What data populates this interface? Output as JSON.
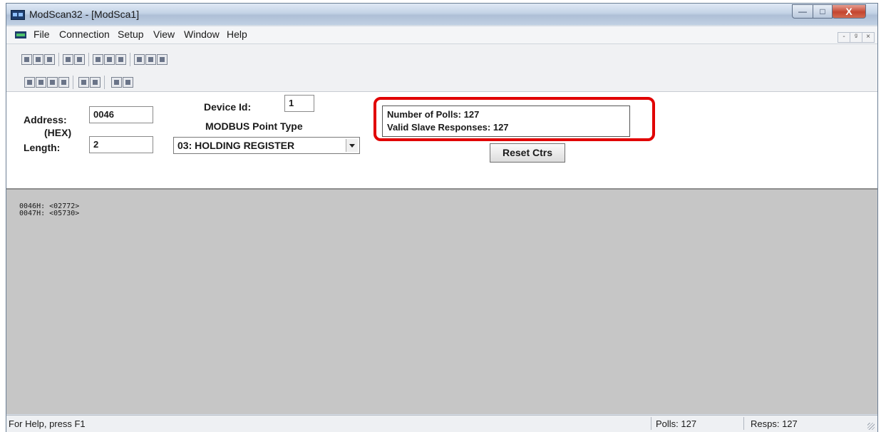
{
  "window": {
    "title": "ModScan32 - [ModSca1]",
    "controls": {
      "minimize": "—",
      "maximize": "□",
      "close": "X"
    }
  },
  "menubar": {
    "items": [
      "File",
      "Connection",
      "Setup",
      "View",
      "Window",
      "Help"
    ],
    "child_controls": {
      "minimize": "-",
      "restore": "ᵍ",
      "close": "×"
    }
  },
  "toolbar": {
    "row1": [
      "new-icon",
      "open-icon",
      "save-icon",
      "connect-icon",
      "disconnect-icon",
      "display-options-icon",
      "poll-icon",
      "write-icon",
      "print-icon",
      "about-icon",
      "help-icon"
    ],
    "row2": [
      "coil-status-icon",
      "input-status-icon",
      "holding-register-icon",
      "input-register-icon",
      "write-coil-icon",
      "write-register-icon",
      "send-icon",
      "receive-icon"
    ]
  },
  "settings": {
    "address_label": "Address:",
    "address_sub": "(HEX)",
    "address_value": "0046",
    "length_label": "Length:",
    "length_value": "2",
    "device_id_label": "Device Id:",
    "device_id_value": "1",
    "point_type_label": "MODBUS Point Type",
    "point_type_value": "03: HOLDING REGISTER"
  },
  "counters": {
    "polls": "Number of Polls: 127",
    "responses": "Valid Slave Responses: 127",
    "reset_label": "Reset Ctrs",
    "highlight_color": "#e10000"
  },
  "data_rows": [
    "0046H:  <02772>",
    "0047H:  <05730>"
  ],
  "status": {
    "help": "For Help, press F1",
    "polls": "Polls: 127",
    "resps": "Resps: 127"
  }
}
